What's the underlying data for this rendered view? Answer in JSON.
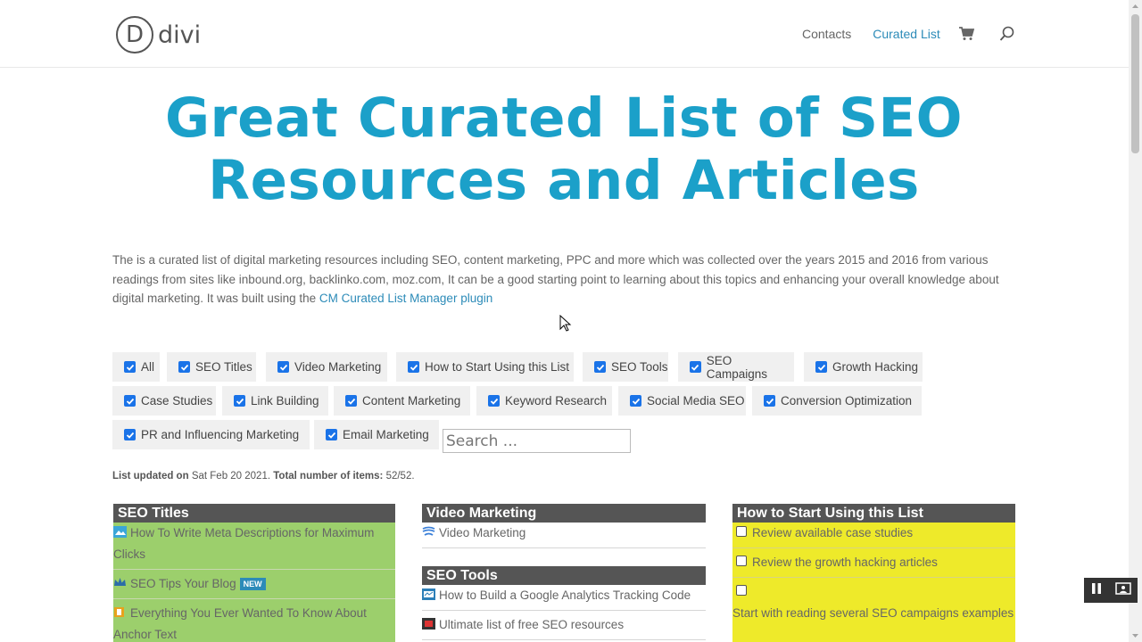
{
  "header": {
    "logo_letter": "D",
    "logo_text": "divi",
    "nav": {
      "contacts": "Contacts",
      "curated": "Curated List"
    },
    "accent_color": "#2c8bb8"
  },
  "title_line1": "Great Curated List of SEO",
  "title_line2": "Resources and Articles",
  "intro": {
    "text": "The is a curated list of digital marketing resources including SEO, content marketing, PPC and more which was collected over the years 2015 and 2016 from various readings from sites like inbound.org, backlinko.com, moz.com, It can be a good starting point to learning about this topics and enhancing your overall knowledge about digital marketing. It was built using the ",
    "link": "CM Curated List Manager plugin"
  },
  "filters": [
    "All",
    "SEO Titles",
    "Video Marketing",
    "How to Start Using this List",
    "SEO Tools",
    "SEO Campaigns",
    "Growth Hacking",
    "Case Studies",
    "Link Building",
    "Content Marketing",
    "Keyword Research",
    "Social Media SEO",
    "Conversion Optimization",
    "PR and Influencing Marketing",
    "Email Marketing"
  ],
  "search": {
    "placeholder": "Search ..."
  },
  "list_updated": {
    "label": "List updated on",
    "date": "Sat Feb 20 2021.",
    "total_label": "Total number of items:",
    "total": "52/52."
  },
  "columns": {
    "seo_titles": {
      "title": "SEO Titles",
      "items": [
        "How To Write Meta Descriptions for Maximum Clicks",
        "SEO Tips Your Blog",
        "Everything You Ever Wanted To Know About Anchor Text"
      ],
      "badge": "NEW",
      "color": "#9ccf6c"
    },
    "video_marketing": {
      "title": "Video Marketing",
      "items": [
        "Video Marketing"
      ]
    },
    "seo_tools": {
      "title": "SEO Tools",
      "items": [
        "How to Build a Google Analytics Tracking Code",
        "Ultimate list of free SEO resources"
      ]
    },
    "how_to_start": {
      "title": "How to Start Using this List",
      "items": [
        "Review available case studies",
        "Review the growth hacking articles",
        "Start with reading several SEO campaigns examples"
      ],
      "color": "#eeea2a"
    }
  }
}
